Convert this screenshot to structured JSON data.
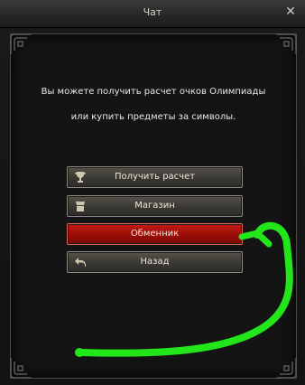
{
  "window": {
    "title": "Чат",
    "close_icon": "close-icon"
  },
  "message": {
    "line1": "Вы можете получить расчет очков Олимпиады",
    "line2": "или купить предметы за символы."
  },
  "buttons": [
    {
      "label": "Получить расчет",
      "icon": "trophy-icon"
    },
    {
      "label": "Магазин",
      "icon": "shop-icon"
    },
    {
      "label": "Обменник",
      "icon": "",
      "highlighted": true
    },
    {
      "label": "Назад",
      "icon": "back-arrow-icon"
    }
  ],
  "colors": {
    "highlight": "#b01208",
    "annotation": "#22e61a",
    "text": "#e8e8e8"
  }
}
